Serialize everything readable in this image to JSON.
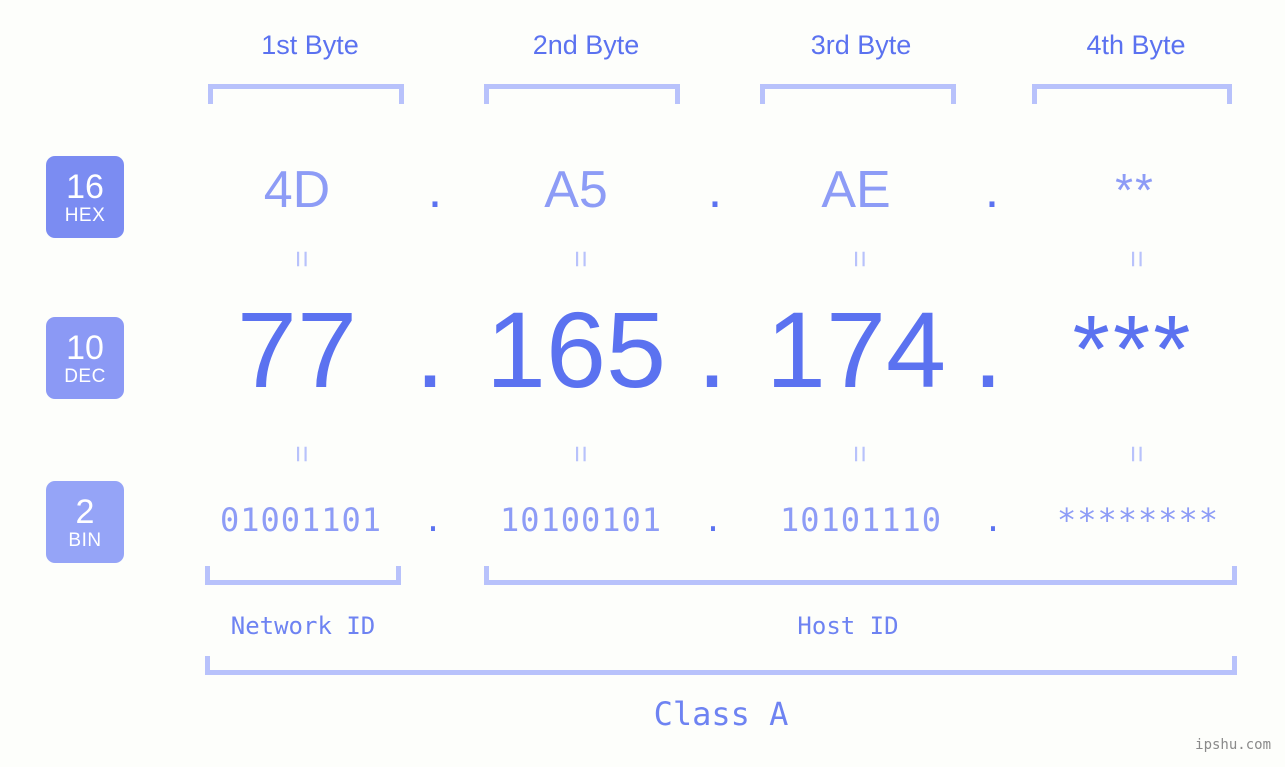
{
  "meta": {
    "background_color": "#fdfefb",
    "accent_color": "#5b72f0",
    "accent_light_color": "#8d9cf6",
    "bracket_color": "#b8c2fb",
    "watermark": "ipshu.com"
  },
  "byte_headers": [
    {
      "label": "1st Byte"
    },
    {
      "label": "2nd Byte"
    },
    {
      "label": "3rd Byte"
    },
    {
      "label": "4th Byte"
    }
  ],
  "bases": [
    {
      "number": "16",
      "name": "HEX",
      "color": "#7b8cf2"
    },
    {
      "number": "10",
      "name": "DEC",
      "color": "#8b99f5"
    },
    {
      "number": "2",
      "name": "BIN",
      "color": "#95a4f7"
    }
  ],
  "separator": ".",
  "equals_sign": "=",
  "rows": {
    "hex": {
      "values": [
        "4D",
        "A5",
        "AE",
        "**"
      ]
    },
    "dec": {
      "values": [
        "77",
        "165",
        "174",
        "***"
      ]
    },
    "bin": {
      "values": [
        "01001101",
        "10100101",
        "10101110",
        "********"
      ]
    }
  },
  "segments": {
    "network_id": "Network ID",
    "host_id": "Host ID",
    "class": "Class A"
  }
}
